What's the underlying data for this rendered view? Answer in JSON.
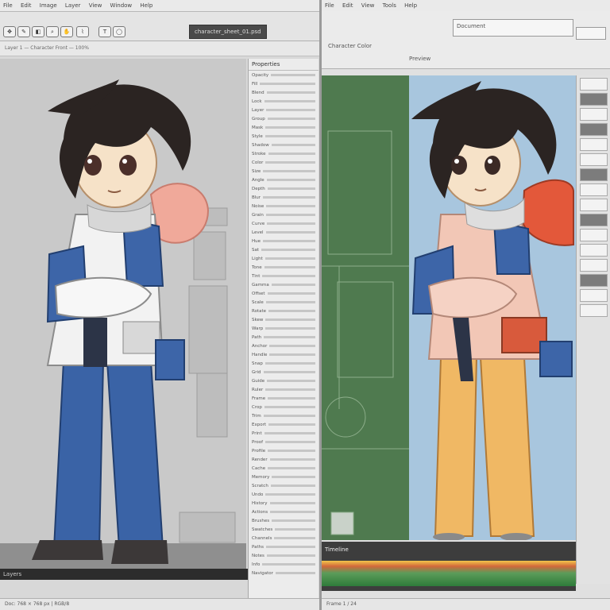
{
  "left_window": {
    "menu": [
      "File",
      "Edit",
      "Image",
      "Layer",
      "View",
      "Window",
      "Help"
    ],
    "file_label": "character_sheet_01.psd",
    "toolbar_icons": [
      "move-icon",
      "brush-icon",
      "eraser-icon",
      "zoom-icon",
      "hand-icon",
      "eyedropper-icon",
      "text-icon",
      "shape-icon"
    ],
    "subbar_text": "Layer 1 — Character Front — 100%",
    "panel_title": "Properties",
    "panel_rows": [
      "Opacity",
      "Fill",
      "Blend",
      "Lock",
      "Layer",
      "Group",
      "Mask",
      "Style",
      "Shadow",
      "Stroke",
      "Color",
      "Size",
      "Angle",
      "Depth",
      "Blur",
      "Noise",
      "Grain",
      "Curve",
      "Level",
      "Hue",
      "Sat",
      "Light",
      "Tone",
      "Tint",
      "Gamma",
      "Offset",
      "Scale",
      "Rotate",
      "Skew",
      "Warp",
      "Path",
      "Anchor",
      "Handle",
      "Snap",
      "Grid",
      "Guide",
      "Ruler",
      "Frame",
      "Crop",
      "Trim",
      "Export",
      "Print",
      "Proof",
      "Profile",
      "Render",
      "Cache",
      "Memory",
      "Scratch",
      "Undo",
      "History",
      "Actions",
      "Brushes",
      "Swatches",
      "Channels",
      "Paths",
      "Notes",
      "Info",
      "Navigator"
    ],
    "layer_strip": "Layers",
    "status": "Doc: 768 × 768 px  |  RGB/8"
  },
  "right_window": {
    "menu": [
      "File",
      "Edit",
      "View",
      "Tools",
      "Help"
    ],
    "header_labels": [
      "Document",
      "Character Color",
      "Preview"
    ],
    "timeline_label": "Timeline",
    "status": "Frame 1 / 24"
  },
  "colors": {
    "hair": "#2b2422",
    "skin": "#f6e2c8",
    "shirt_blue": "#3d65a8",
    "jacket_white": "#f2f2f2",
    "pants_blue": "#3a63a6",
    "pants_orange": "#f0b864",
    "top_pink": "#f2c7b6",
    "accent_red": "#e3583a",
    "green_panel": "#4f7a4f",
    "blue_canvas": "#a8c6de"
  }
}
